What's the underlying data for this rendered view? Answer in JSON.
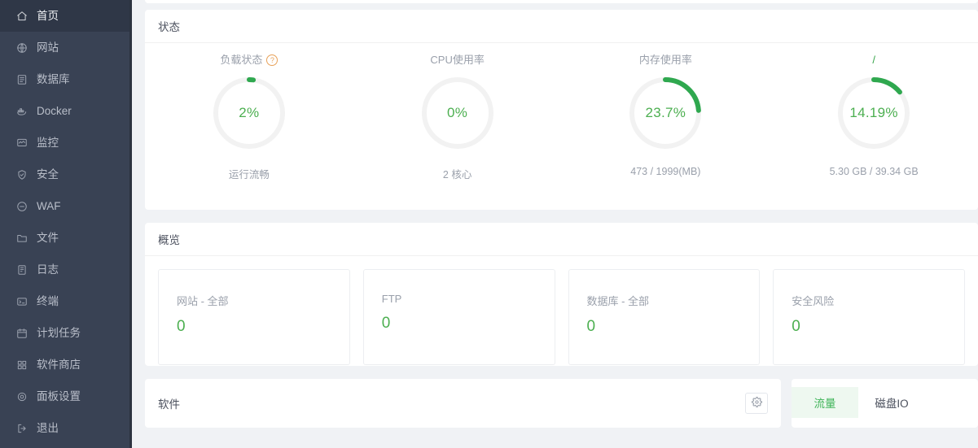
{
  "colors": {
    "accent_green": "#4caf50",
    "arc_green": "#2fa84f",
    "sidebar_bg": "#394254",
    "page_bg": "#f0f2f5",
    "help_orange": "#e8a158"
  },
  "sidebar": {
    "items": [
      {
        "label": "首页",
        "icon": "home-icon",
        "active": true
      },
      {
        "label": "网站",
        "icon": "globe-icon",
        "active": false
      },
      {
        "label": "数据库",
        "icon": "database-icon",
        "active": false
      },
      {
        "label": "Docker",
        "icon": "docker-icon",
        "active": false
      },
      {
        "label": "监控",
        "icon": "monitor-icon",
        "active": false
      },
      {
        "label": "安全",
        "icon": "shield-check-icon",
        "active": false
      },
      {
        "label": "WAF",
        "icon": "shield-minus-icon",
        "active": false
      },
      {
        "label": "文件",
        "icon": "folder-icon",
        "active": false
      },
      {
        "label": "日志",
        "icon": "log-icon",
        "active": false
      },
      {
        "label": "终端",
        "icon": "terminal-icon",
        "active": false
      },
      {
        "label": "计划任务",
        "icon": "calendar-icon",
        "active": false
      },
      {
        "label": "软件商店",
        "icon": "apps-grid-icon",
        "active": false
      },
      {
        "label": "面板设置",
        "icon": "gear-icon",
        "active": false
      },
      {
        "label": "退出",
        "icon": "logout-icon",
        "active": false
      }
    ]
  },
  "status": {
    "title": "状态",
    "gauges": [
      {
        "label": "负载状态",
        "has_help": true,
        "help_glyph": "?",
        "value": "2%",
        "percent": 2,
        "sub": "运行流畅",
        "label_green": false
      },
      {
        "label": "CPU使用率",
        "has_help": false,
        "value": "0%",
        "percent": 0,
        "sub": "2 核心",
        "label_green": false
      },
      {
        "label": "内存使用率",
        "has_help": false,
        "value": "23.7%",
        "percent": 23.7,
        "sub": "473 / 1999(MB)",
        "label_green": false
      },
      {
        "label": "/",
        "has_help": false,
        "value": "14.19%",
        "percent": 14.19,
        "sub": "5.30 GB / 39.34 GB",
        "label_green": true
      }
    ]
  },
  "overview": {
    "title": "概览",
    "boxes": [
      {
        "name": "网站 - 全部",
        "value": "0"
      },
      {
        "name": "FTP",
        "value": "0"
      },
      {
        "name": "数据库 - 全部",
        "value": "0"
      },
      {
        "name": "安全风险",
        "value": "0"
      }
    ]
  },
  "software": {
    "title": "软件",
    "settings_icon": "gear-icon"
  },
  "chart_panel": {
    "tabs": [
      {
        "label": "流量",
        "active": true
      },
      {
        "label": "磁盘IO",
        "active": false
      }
    ]
  }
}
